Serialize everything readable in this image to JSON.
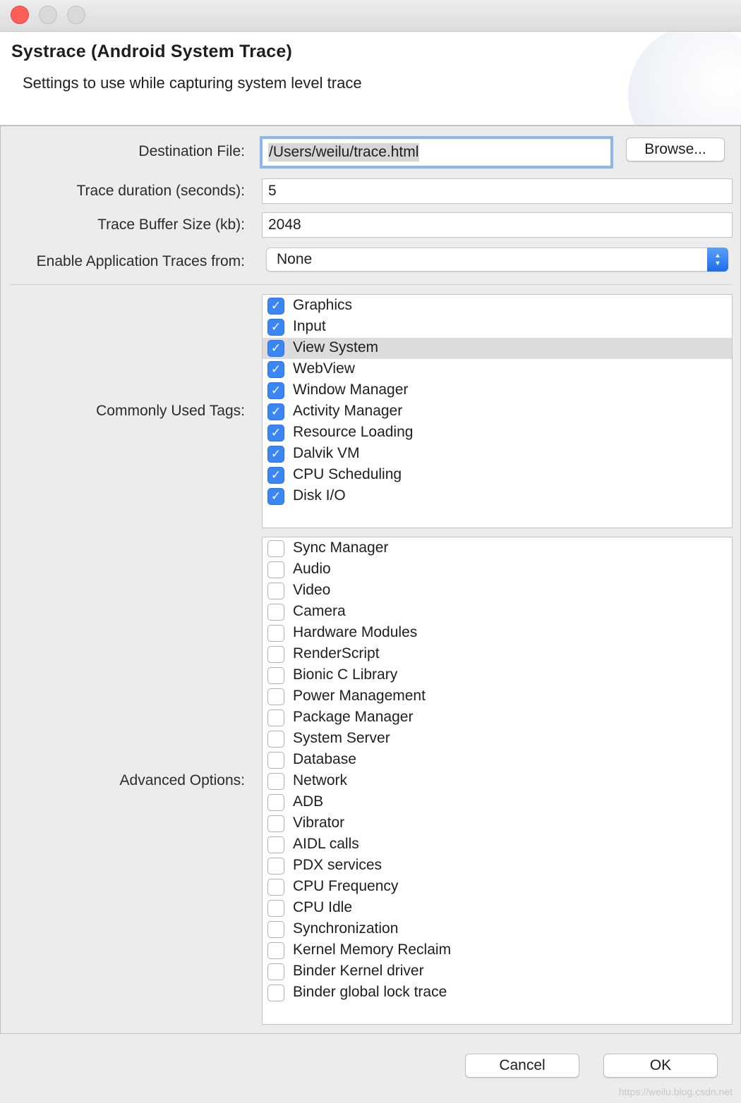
{
  "window": {
    "controls": [
      "close",
      "minimize",
      "zoom"
    ]
  },
  "header": {
    "title": "Systrace (Android System Trace)",
    "subtitle": "Settings to use while capturing system level trace"
  },
  "form": {
    "destination_label": "Destination File:",
    "destination_value": "/Users/weilu/trace.html",
    "browse_label": "Browse...",
    "duration_label": "Trace duration (seconds):",
    "duration_value": "5",
    "buffer_label": "Trace Buffer Size (kb):",
    "buffer_value": "2048",
    "app_traces_label": "Enable Application Traces from:",
    "app_traces_value": "None",
    "common_tags_label": "Commonly Used Tags:",
    "advanced_label": "Advanced Options:"
  },
  "common_tags": [
    {
      "label": "Graphics",
      "checked": true
    },
    {
      "label": "Input",
      "checked": true
    },
    {
      "label": "View System",
      "checked": true,
      "highlighted": true
    },
    {
      "label": "WebView",
      "checked": true
    },
    {
      "label": "Window Manager",
      "checked": true
    },
    {
      "label": "Activity Manager",
      "checked": true
    },
    {
      "label": "Resource Loading",
      "checked": true
    },
    {
      "label": "Dalvik VM",
      "checked": true
    },
    {
      "label": "CPU Scheduling",
      "checked": true
    },
    {
      "label": "Disk I/O",
      "checked": true
    }
  ],
  "advanced_tags": [
    {
      "label": "Sync Manager",
      "checked": false
    },
    {
      "label": "Audio",
      "checked": false
    },
    {
      "label": "Video",
      "checked": false
    },
    {
      "label": "Camera",
      "checked": false
    },
    {
      "label": "Hardware Modules",
      "checked": false
    },
    {
      "label": "RenderScript",
      "checked": false
    },
    {
      "label": "Bionic C Library",
      "checked": false
    },
    {
      "label": "Power Management",
      "checked": false
    },
    {
      "label": "Package Manager",
      "checked": false
    },
    {
      "label": "System Server",
      "checked": false
    },
    {
      "label": "Database",
      "checked": false
    },
    {
      "label": "Network",
      "checked": false
    },
    {
      "label": "ADB",
      "checked": false
    },
    {
      "label": "Vibrator",
      "checked": false
    },
    {
      "label": "AIDL calls",
      "checked": false
    },
    {
      "label": "PDX services",
      "checked": false
    },
    {
      "label": "CPU Frequency",
      "checked": false
    },
    {
      "label": "CPU Idle",
      "checked": false
    },
    {
      "label": "Synchronization",
      "checked": false
    },
    {
      "label": "Kernel Memory Reclaim",
      "checked": false
    },
    {
      "label": "Binder Kernel driver",
      "checked": false
    },
    {
      "label": "Binder global lock trace",
      "checked": false
    }
  ],
  "footer": {
    "cancel_label": "Cancel",
    "ok_label": "OK",
    "watermark": "https://weilu.blog.csdn.net"
  },
  "colors": {
    "accent": "#3a86f5",
    "close_button": "#fc5f57"
  }
}
